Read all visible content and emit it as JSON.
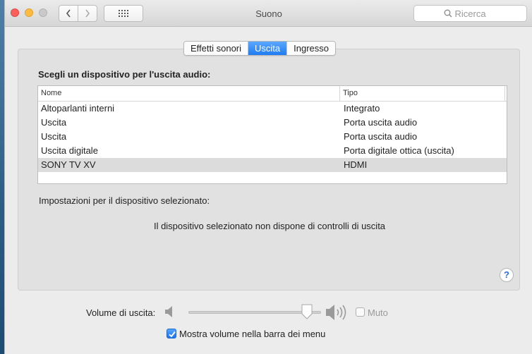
{
  "window": {
    "title": "Suono"
  },
  "search": {
    "placeholder": "Ricerca"
  },
  "tabs": [
    {
      "label": "Effetti sonori",
      "active": false
    },
    {
      "label": "Uscita",
      "active": true
    },
    {
      "label": "Ingresso",
      "active": false
    }
  ],
  "output": {
    "section_title": "Scegli un dispositivo per l'uscita audio:",
    "columns": {
      "name": "Nome",
      "type": "Tipo"
    },
    "devices": [
      {
        "name": "Altoparlanti interni",
        "type": "Integrato",
        "selected": false
      },
      {
        "name": "Uscita",
        "type": "Porta uscita audio",
        "selected": false
      },
      {
        "name": "Uscita",
        "type": "Porta uscita audio",
        "selected": false
      },
      {
        "name": "Uscita digitale",
        "type": "Porta digitale ottica (uscita)",
        "selected": false
      },
      {
        "name": "SONY TV XV",
        "type": "HDMI",
        "selected": true
      }
    ],
    "settings_label": "Impostazioni per il dispositivo selezionato:",
    "no_controls_message": "Il dispositivo selezionato non dispone di controlli di uscita",
    "help_label": "?"
  },
  "volume": {
    "label": "Volume di uscita:",
    "level": 0.93,
    "mute_label": "Muto",
    "mute_checked": false
  },
  "menu_bar": {
    "label": "Mostra volume nella barra dei menu",
    "checked": true
  },
  "colors": {
    "accent": "#1f7cf1",
    "selected_row": "#dcdcdc"
  },
  "icons": {
    "back": "chevron-left-icon",
    "forward": "chevron-right-icon",
    "grid": "grid-icon",
    "search": "magnifier-icon",
    "volume_low": "speaker-low-icon",
    "volume_high": "speaker-high-icon"
  }
}
